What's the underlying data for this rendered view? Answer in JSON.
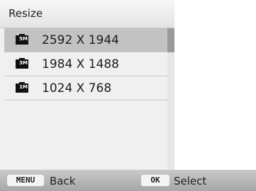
{
  "title": "Resize",
  "options": [
    {
      "label": "2592 X 1944",
      "icon": "size-5m-icon",
      "badge": "5M",
      "selected": true
    },
    {
      "label": "1984 X 1488",
      "icon": "size-3m-icon",
      "badge": "3M",
      "selected": false
    },
    {
      "label": "1024 X 768",
      "icon": "size-1m-icon",
      "badge": "1M",
      "selected": false
    }
  ],
  "footer": {
    "menu_key": "MENU",
    "back_label": "Back",
    "ok_key": "OK",
    "select_label": "Select"
  },
  "colors": {
    "panel_bg": "#f0f0f0",
    "selected_row": "#c2c2c2",
    "scroll_thumb": "#9a9a9a",
    "bottom_bar": "#b5b5b5"
  }
}
